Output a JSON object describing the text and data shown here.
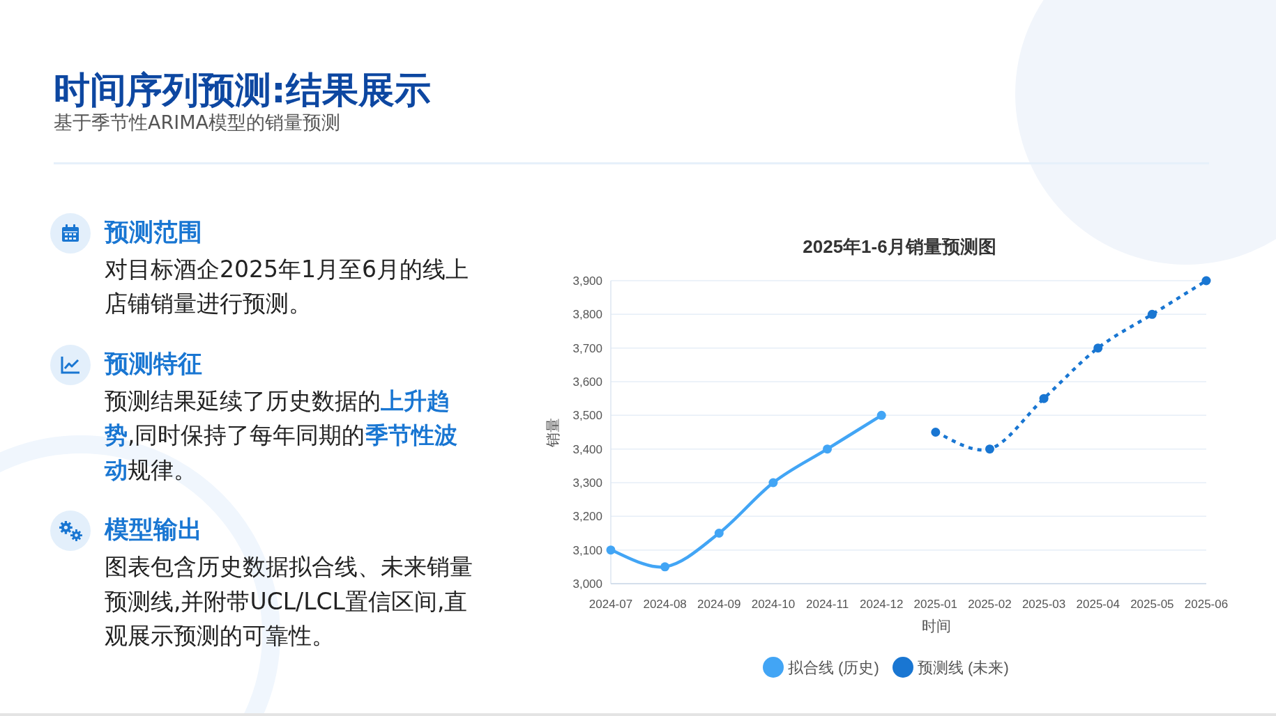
{
  "title": "时间序列预测:结果展示",
  "subtitle": "基于季节性ARIMA模型的销量预测",
  "sections": [
    {
      "kind": "calendar",
      "heading": "预测范围",
      "body": "对目标酒企2025年1月至6月的线上店铺销量进行预测。"
    },
    {
      "kind": "chart",
      "heading": "预测特征",
      "body": "预测结果延续了历史数据的**上升趋势**,同时保持了每年同期的**季节性波动**规律。"
    },
    {
      "kind": "gears",
      "heading": "模型输出",
      "body": "图表包含历史数据拟合线、未来销量预测线,并附带UCL/LCL置信区间,直观展示预测的可靠性。"
    }
  ],
  "chart": {
    "chart_data": {
      "type": "line",
      "title": "2025年1-6月销量预测图",
      "xlabel": "时间",
      "ylabel": "销量",
      "grid": true,
      "legend": "bottom",
      "categories": [
        "2024-07",
        "2024-08",
        "2024-09",
        "2024-10",
        "2024-11",
        "2024-12",
        "2025-01",
        "2025-02",
        "2025-03",
        "2025-04",
        "2025-05",
        "2025-06"
      ],
      "series": [
        {
          "name": "拟合线 (历史)",
          "color": "#42a5f5",
          "marker": "circle",
          "line_style": "solid",
          "values": [
            3100,
            3050,
            3150,
            3300,
            3400,
            3500,
            null,
            null,
            null,
            null,
            null,
            null
          ]
        },
        {
          "name": "预测线 (未来)",
          "color": "#1976d2",
          "marker": "circle",
          "line_style": "dashed",
          "values": [
            null,
            null,
            null,
            null,
            null,
            null,
            3450,
            3400,
            3550,
            3700,
            3800,
            3900
          ]
        }
      ],
      "ylim": [
        3000,
        3900
      ],
      "yticks": [
        {
          "value": 3000,
          "label": "3,000"
        },
        {
          "value": 3100,
          "label": "3,100"
        },
        {
          "value": 3200,
          "label": "3,200"
        },
        {
          "value": 3300,
          "label": "3,300"
        },
        {
          "value": 3400,
          "label": "3,400"
        },
        {
          "value": 3500,
          "label": "3,500"
        },
        {
          "value": 3600,
          "label": "3,600"
        },
        {
          "value": 3700,
          "label": "3,700"
        },
        {
          "value": 3800,
          "label": "3,800"
        },
        {
          "value": 3900,
          "label": "3,900"
        }
      ]
    }
  }
}
